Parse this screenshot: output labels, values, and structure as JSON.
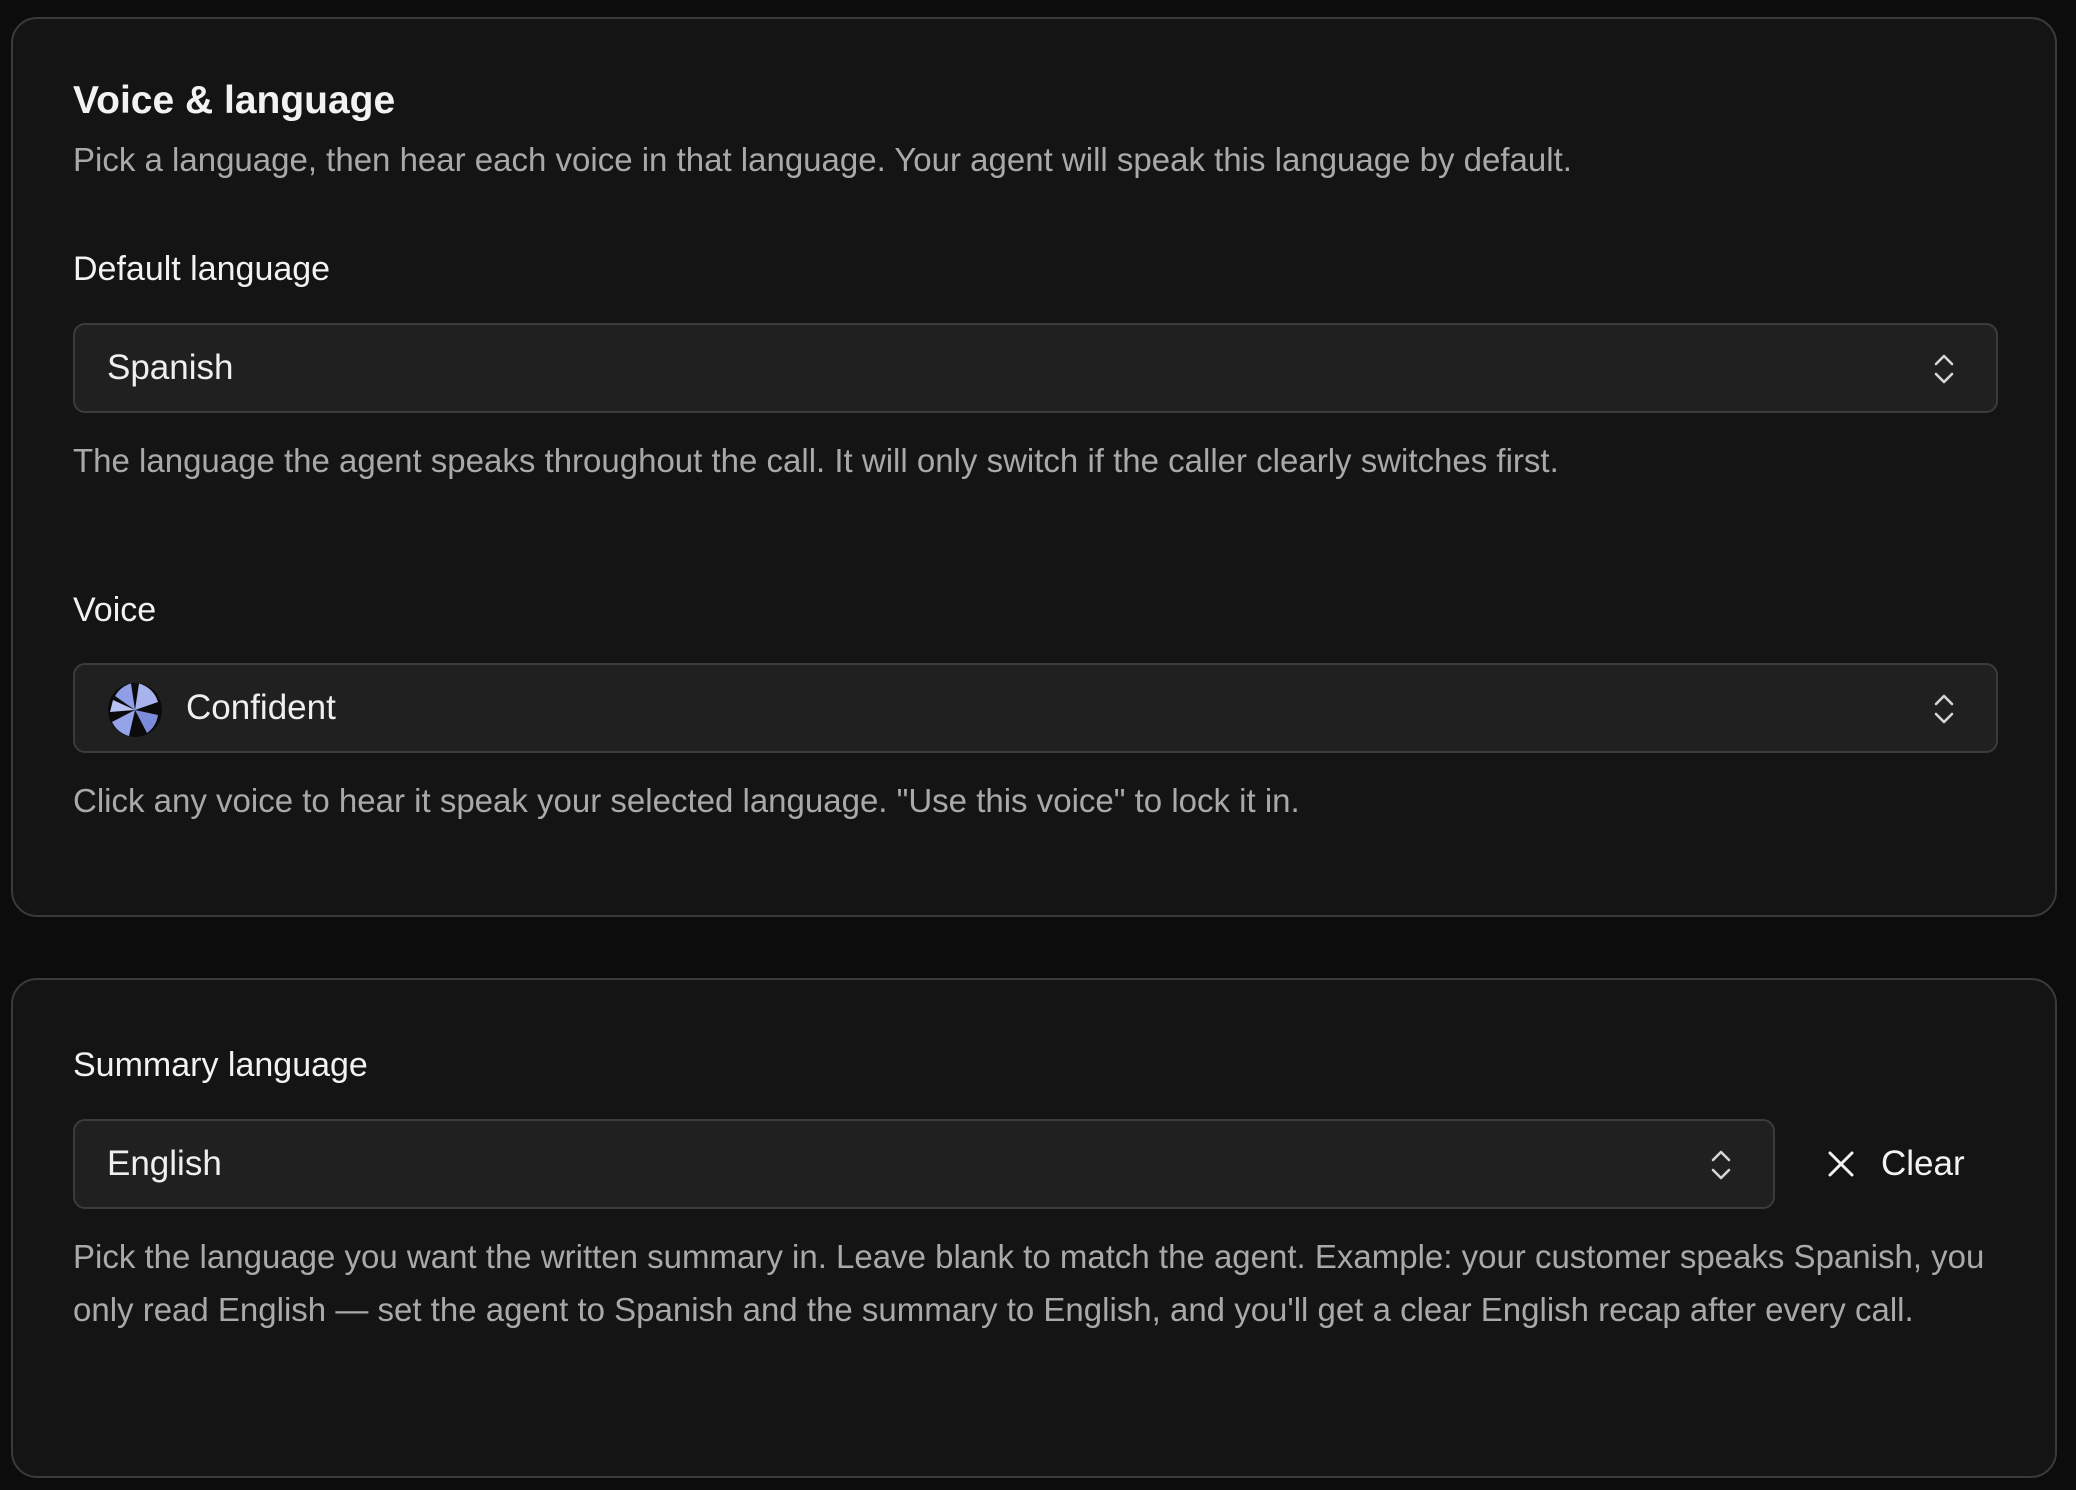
{
  "voice_section": {
    "title": "Voice & language",
    "description": "Pick a language, then hear each voice in that language. Your agent will speak this language by default.",
    "default_language": {
      "label": "Default language",
      "value": "Spanish",
      "help": "The language the agent speaks throughout the call. It will only switch if the caller clearly switches first."
    },
    "voice": {
      "label": "Voice",
      "value": "Confident",
      "help": "Click any voice to hear it speak your selected language. \"Use this voice\" to lock it in."
    }
  },
  "summary_section": {
    "label": "Summary language",
    "value": "English",
    "clear_label": "Clear",
    "help": "Pick the language you want the written summary in. Leave blank to match the agent. Example: your customer speaks Spanish, you only read English — set the agent to Spanish and the summary to English, and you'll get a clear English recap after every call."
  },
  "colors": {
    "background": "#0c0c0c",
    "card": "#141414",
    "card_border": "#3a3a3a",
    "field": "#202020",
    "avatar_accent": "#8f9ee6"
  }
}
